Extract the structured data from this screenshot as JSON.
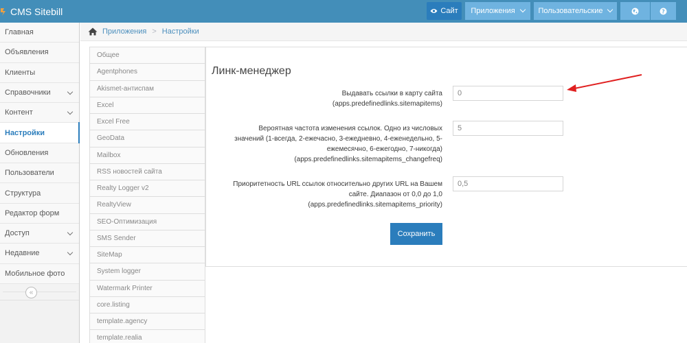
{
  "navbar": {
    "brand": "CMS Sitebill",
    "site_label": "Сайт",
    "apps_label": "Приложения",
    "users_label": "Пользовательские"
  },
  "sidebar": {
    "items": [
      {
        "label": "Главная"
      },
      {
        "label": "Объявления"
      },
      {
        "label": "Клиенты"
      },
      {
        "label": "Справочники"
      },
      {
        "label": "Контент"
      },
      {
        "label": "Настройки"
      },
      {
        "label": "Обновления"
      },
      {
        "label": "Пользователи"
      },
      {
        "label": "Структура"
      },
      {
        "label": "Редактор форм"
      },
      {
        "label": "Доступ"
      },
      {
        "label": "Недавние"
      },
      {
        "label": "Мобильное фото"
      }
    ],
    "collapse_glyph": "«"
  },
  "breadcrumb": {
    "items": [
      "Приложения",
      "Настройки"
    ],
    "separator": ">"
  },
  "submenu": {
    "items": [
      "Общее",
      "Agentphones",
      "Akismet-антиспам",
      "Excel",
      "Excel Free",
      "GeoData",
      "Mailbox",
      "RSS новостей сайта",
      "Realty Logger v2",
      "RealtyView",
      "SEO-Оптимизация",
      "SMS Sender",
      "SiteMap",
      "System logger",
      "Watermark Printer",
      "core.listing",
      "template.agency",
      "template.realia"
    ]
  },
  "form": {
    "title": "Линк-менеджер",
    "fields": [
      {
        "label_lines": [
          "Выдавать ссылки в карту сайта",
          "(apps.predefinedlinks.sitemapitems)"
        ],
        "value": "0"
      },
      {
        "label_lines": [
          "Вероятная частота изменения ссылок. Одно из числовых",
          "значений (1-всегда, 2-ежечасно, 3-ежедневно, 4-еженедельно, 5-",
          "ежемесячно, 6-ежегодно, 7-никогда)",
          "(apps.predefinedlinks.sitemapitems_changefreq)"
        ],
        "value": "5"
      },
      {
        "label_lines": [
          "Приоритетность URL ссылок относительно других URL на Вашем",
          "сайте. Диапазон от 0,0 до 1,0",
          "(apps.predefinedlinks.sitemapitems_priority)"
        ],
        "value": "0,5"
      }
    ],
    "save_label": "Сохранить"
  },
  "colors": {
    "navbar": "#438eb9",
    "primary": "#2b7dbc",
    "arrow": "#e02020"
  }
}
